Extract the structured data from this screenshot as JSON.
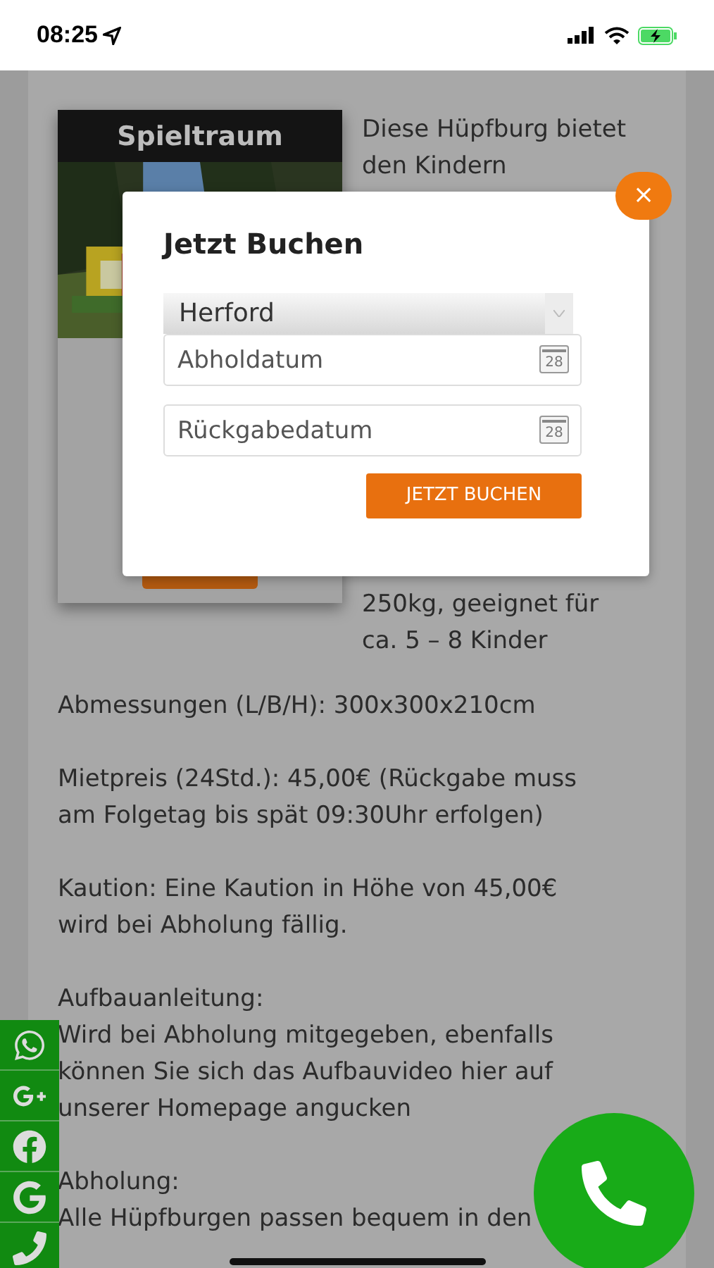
{
  "status_bar": {
    "time": "08:25"
  },
  "product": {
    "title": "Spieltraum",
    "intro_top": "Diese Hüpfburg bietet den Kindern",
    "intro_bottom": "250kg, geeignet für ca. 5 – 8 Kinder"
  },
  "paragraphs": [
    {
      "text": "Abmessungen (L/B/H): 300x300x210cm"
    },
    {
      "text": "Mietpreis (24Std.): 45,00€ (Rückgabe muss am Folgetag bis spät 09:30Uhr erfolgen)"
    },
    {
      "text": "Kaution: Eine Kaution in Höhe von 45,00€ wird bei Abholung fällig."
    },
    {
      "heading": "Aufbauanleitung:",
      "text": "Wird bei Abholung mitgegeben, ebenfalls können Sie sich das Aufbauvideo hier auf unserer Homepage angucken"
    },
    {
      "heading": "Abholung:",
      "text": "Alle Hüpfburgen passen bequem in den"
    }
  ],
  "social_bar": [
    {
      "kind": "whatsapp"
    },
    {
      "kind": "googleplus"
    },
    {
      "kind": "facebook"
    },
    {
      "kind": "google"
    },
    {
      "kind": "phone"
    }
  ],
  "modal": {
    "close": "×",
    "title": "Jetzt Buchen",
    "location": "Herford",
    "fields": [
      {
        "placeholder": "Abholdatum",
        "calendar_day": "28"
      },
      {
        "placeholder": "Rückgabedatum",
        "calendar_day": "28"
      }
    ],
    "button": "JETZT BUCHEN"
  }
}
